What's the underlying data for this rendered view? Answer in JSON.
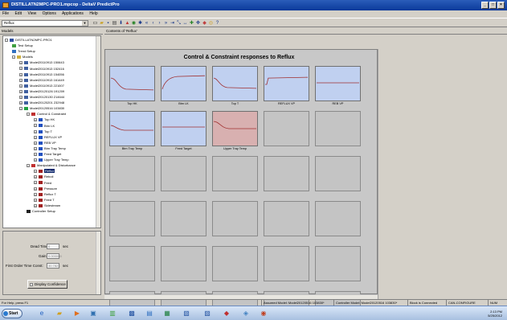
{
  "window": {
    "title": "DISTILLATN2MPC-PRO1.mpcop - DeltaV PredictPro",
    "controls": [
      "_",
      "□",
      "×"
    ]
  },
  "menu": [
    "File",
    "Edit",
    "View",
    "Options",
    "Applications",
    "Help"
  ],
  "toolbar": {
    "combo_value": "Reflux",
    "icons": [
      "new",
      "open",
      "save",
      "print",
      "down",
      "plot",
      "zoom",
      "scan",
      "first",
      "prev",
      "next",
      "last",
      "last2",
      "fit",
      "range",
      "add",
      "move",
      "config",
      "step",
      "help"
    ]
  },
  "panes": {
    "left_title": "Models",
    "right_title": "Contents of 'Reflux'"
  },
  "tree": [
    {
      "label": "DISTILLATN2MPC-PRO1",
      "level": 0,
      "pm": "−",
      "icon": "app"
    },
    {
      "label": "Test Setup",
      "level": 1,
      "pm": "",
      "icon": "test"
    },
    {
      "label": "Trend Setup",
      "level": 1,
      "pm": "",
      "icon": "trend"
    },
    {
      "label": "Models",
      "level": 1,
      "pm": "−",
      "icon": "folder"
    },
    {
      "label": "Model20110913 150643",
      "level": 2,
      "pm": "+",
      "icon": "model"
    },
    {
      "label": "Model20110913 152416",
      "level": 2,
      "pm": "+",
      "icon": "model"
    },
    {
      "label": "Model20110913 154056",
      "level": 2,
      "pm": "+",
      "icon": "model"
    },
    {
      "label": "Model20110913 161449",
      "level": 2,
      "pm": "+",
      "icon": "model"
    },
    {
      "label": "Model20110913 221007",
      "level": 2,
      "pm": "+",
      "icon": "model"
    },
    {
      "label": "Model20120126 191209",
      "level": 2,
      "pm": "+",
      "icon": "model"
    },
    {
      "label": "Model20120130 214644",
      "level": 2,
      "pm": "+",
      "icon": "model"
    },
    {
      "label": "Model20120201 232948",
      "level": 2,
      "pm": "+",
      "icon": "model"
    },
    {
      "label": "Model20120516 103830",
      "level": 2,
      "pm": "−",
      "icon": "model-active"
    },
    {
      "label": "Control & Constraint",
      "level": 3,
      "pm": "−",
      "icon": "cc"
    },
    {
      "label": "Top HK",
      "level": 4,
      "pm": "+",
      "icon": "out"
    },
    {
      "label": "Btm LK",
      "level": 4,
      "pm": "+",
      "icon": "out"
    },
    {
      "label": "Top T",
      "level": 4,
      "pm": "+",
      "icon": "out"
    },
    {
      "label": "REFLUX VP",
      "level": 4,
      "pm": "+",
      "icon": "out"
    },
    {
      "label": "REB VP",
      "level": 4,
      "pm": "+",
      "icon": "out"
    },
    {
      "label": "Btm Tray Temp",
      "level": 4,
      "pm": "+",
      "icon": "out"
    },
    {
      "label": "Feed Target",
      "level": 4,
      "pm": "+",
      "icon": "out"
    },
    {
      "label": "Upper Tray Temp",
      "level": 4,
      "pm": "+",
      "icon": "out"
    },
    {
      "label": "Manipulated & Disturbance",
      "level": 3,
      "pm": "−",
      "icon": "md"
    },
    {
      "label": "Reflux",
      "level": 4,
      "pm": "+",
      "icon": "in",
      "selected": true
    },
    {
      "label": "Reboil",
      "level": 4,
      "pm": "+",
      "icon": "in"
    },
    {
      "label": "Feed",
      "level": 4,
      "pm": "+",
      "icon": "in"
    },
    {
      "label": "Pressure",
      "level": 4,
      "pm": "+",
      "icon": "in"
    },
    {
      "label": "Reflux T",
      "level": 4,
      "pm": "+",
      "icon": "in"
    },
    {
      "label": "Feed T",
      "level": 4,
      "pm": "+",
      "icon": "in"
    },
    {
      "label": "Sidestream",
      "level": 4,
      "pm": "+",
      "icon": "in"
    },
    {
      "label": "Controller Setup",
      "level": 3,
      "pm": "",
      "icon": "setup"
    }
  ],
  "properties": {
    "dead_time_label": "Dead Time:",
    "dead_time_value": "0",
    "dead_time_unit": "sec",
    "gain_label": "Gain:",
    "gain_value": "0.000000",
    "tc_label": "First Order Time Const:",
    "tc_value": "30.7823",
    "tc_unit": "sec",
    "confidence_label": "Display Confidence"
  },
  "chart_grid": {
    "title": "Control & Constraint responses to  Reflux",
    "cells": [
      {
        "label": "Top HK",
        "state": "active",
        "curve": "down"
      },
      {
        "label": "Btm LK",
        "state": "active",
        "curve": "up"
      },
      {
        "label": "Top T",
        "state": "active",
        "curve": "down2"
      },
      {
        "label": "REFLUX VP",
        "state": "active",
        "curve": "step-up"
      },
      {
        "label": "REB VP",
        "state": "active",
        "curve": "flat"
      },
      {
        "label": "Btm Tray Temp",
        "state": "active",
        "curve": "down3"
      },
      {
        "label": "Feed Target",
        "state": "active",
        "curve": "flat2"
      },
      {
        "label": "Upper Tray Temp",
        "state": "warn",
        "curve": "dip"
      }
    ],
    "empty_cells": 22
  },
  "status": {
    "help": "For Help, press F1",
    "assumed": "Assumed Model: Model20120516 103830*",
    "controller": "Controller Model: Model20120516 103830*",
    "block": "Block is Connected",
    "config": "CAN-CONFIGURE",
    "num": "NUM"
  },
  "taskbar": {
    "start": "Start",
    "time": "2:13 PM",
    "date": "5/25/2012"
  },
  "colors": {
    "title_bar": "#0a3a9a",
    "cell_active": "#c0d0f0",
    "cell_warn": "#d8b0b0",
    "curve": "#a03030"
  }
}
